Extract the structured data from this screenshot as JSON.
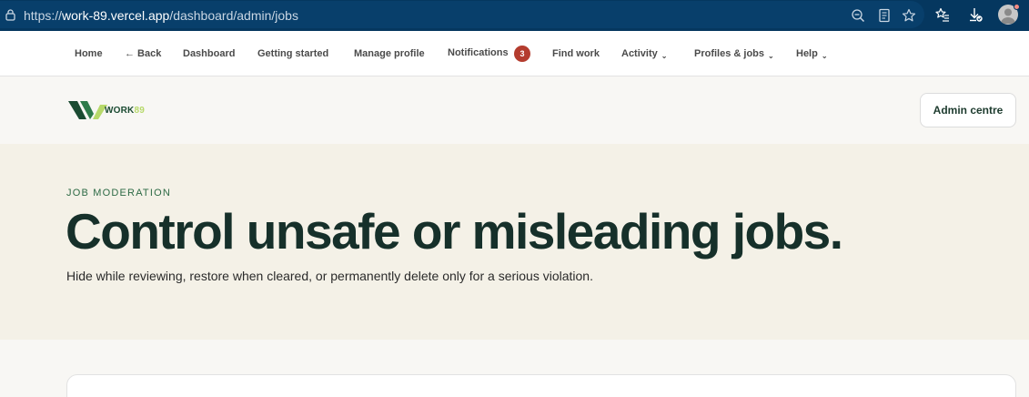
{
  "browser": {
    "url_prefix": "https://",
    "url_host": "work-89.vercel.app",
    "url_path": "/dashboard/admin/jobs",
    "icons": [
      "lock-icon",
      "zoom-icon",
      "reader-icon",
      "star-icon",
      "favorites-icon",
      "download-icon",
      "profile-icon"
    ]
  },
  "nav": {
    "items": [
      {
        "label": "Home"
      },
      {
        "label": "← Back"
      },
      {
        "label": "Dashboard"
      },
      {
        "label": "Getting started"
      },
      {
        "label": "Manage profile"
      },
      {
        "label": "Notifications",
        "badge": "3"
      },
      {
        "label": "Find work"
      },
      {
        "label": "Activity",
        "caret": "⌄"
      },
      {
        "label": "Profiles & jobs",
        "caret": "⌄"
      },
      {
        "label": "Help",
        "caret": "⌄"
      }
    ]
  },
  "header": {
    "logo_word": "WORK",
    "logo_num": "89",
    "admin_button": "Admin centre"
  },
  "hero": {
    "eyebrow": "JOB MODERATION",
    "title": "Control unsafe or misleading jobs.",
    "subtitle": "Hide while reviewing, restore when cleared, or permanently delete only for a serious violation."
  },
  "colors": {
    "browser_bar": "#05375f",
    "badge": "#b43c2e",
    "hero_bg": "#f4f1e7",
    "headline": "#16302a",
    "logo_green": "#1b4b32",
    "logo_lime": "#b7d96a"
  }
}
